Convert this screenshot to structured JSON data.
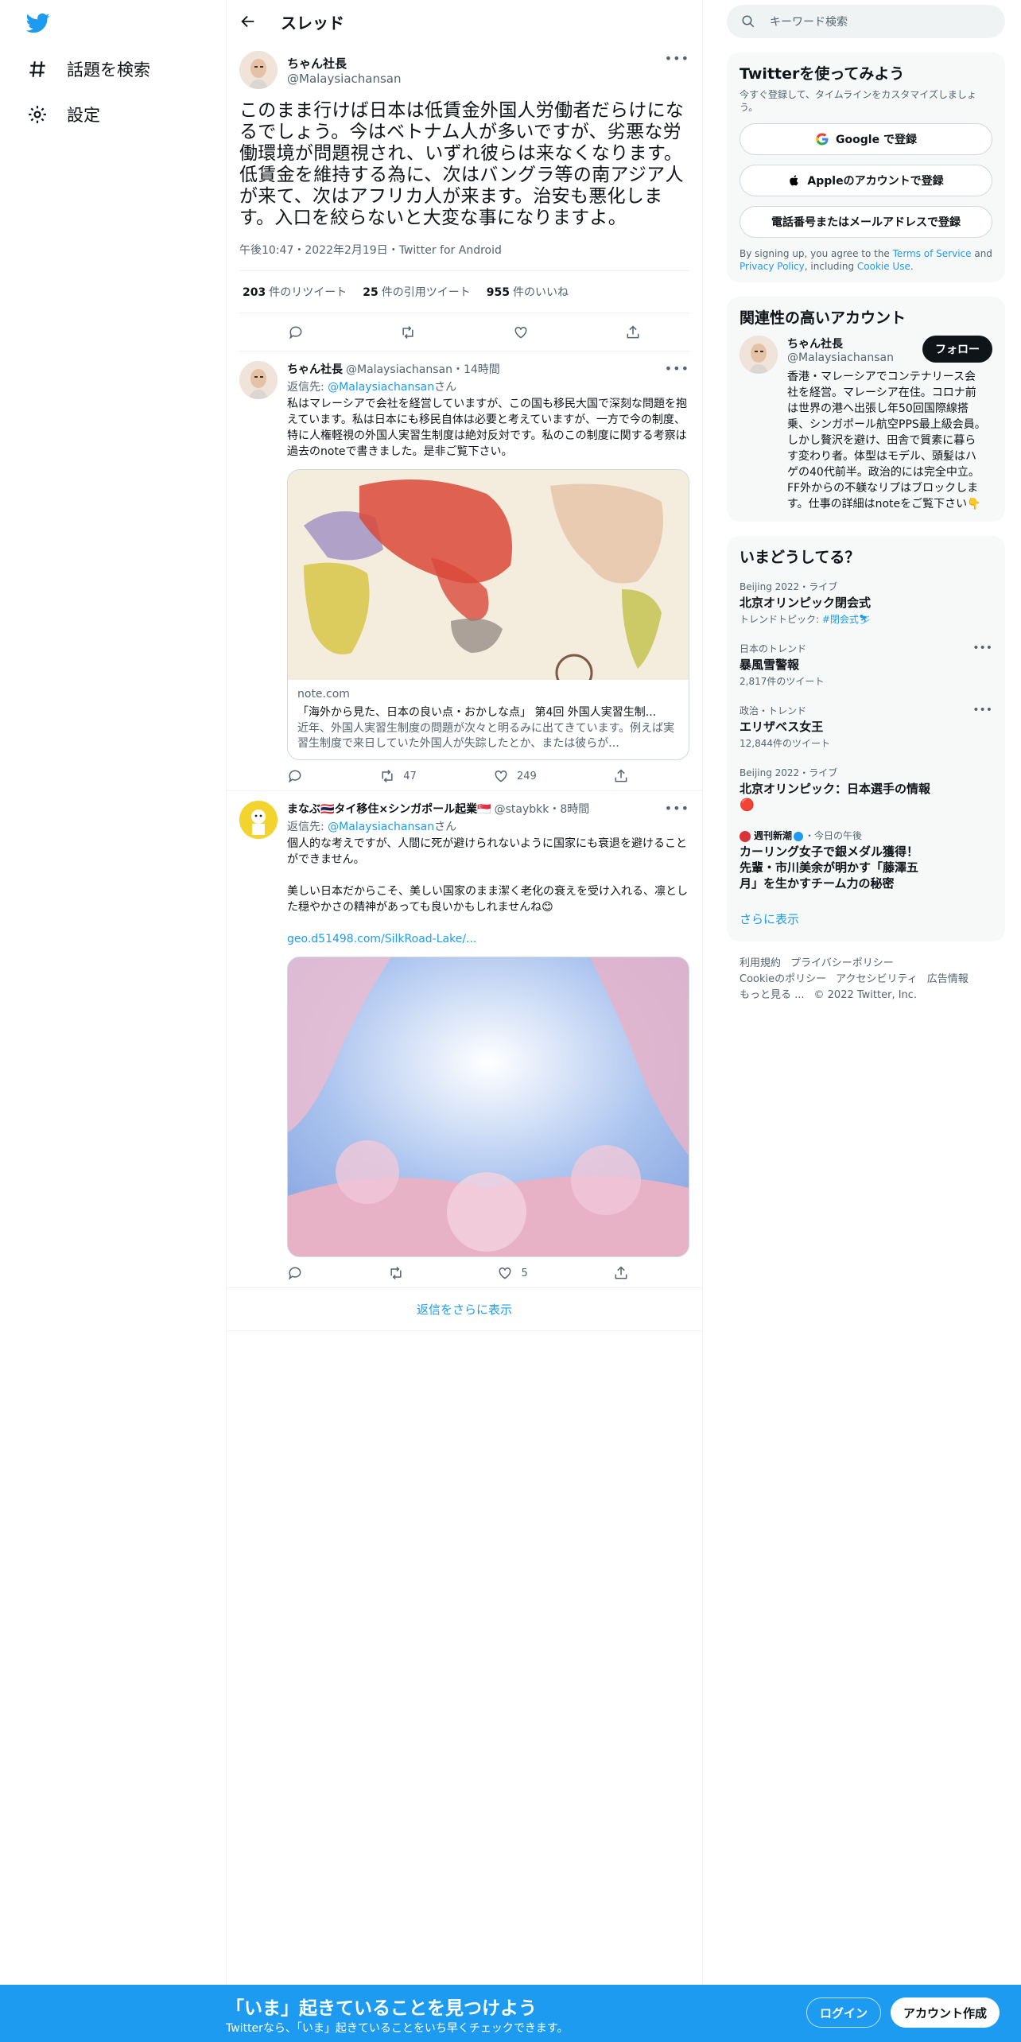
{
  "nav": {
    "explore_label": "話題を検索",
    "settings_label": "設定"
  },
  "header": {
    "title": "スレッド"
  },
  "main_tweet": {
    "name": "ちゃん社長",
    "handle": "@Malaysiachansan",
    "text": "このまま行けば日本は低賃金外国人労働者だらけになるでしょう。今はベトナム人が多いですが、劣悪な労働環境が問題視され、いずれ彼らは来なくなります。低賃金を維持する為に、次はバングラ等の南アジア人が来て、次はアフリカ人が来ます。治安も悪化します。入口を絞らないと大変な事になりますよ。",
    "meta": "午後10:47・2022年2月19日・Twitter for Android",
    "retweets": "203",
    "retweets_label": "件のリツイート",
    "quotes": "25",
    "quotes_label": "件の引用ツイート",
    "likes": "955",
    "likes_label": "件のいいね"
  },
  "replies": [
    {
      "name": "ちゃん社長",
      "handle_time": "@Malaysiachansan・14時間",
      "reply_to_prefix": "返信先: ",
      "reply_to_handle": "@Malaysiachansan",
      "reply_to_suffix": "さん",
      "text": "私はマレーシアで会社を経営していますが、この国も移民大国で深刻な問題を抱えています。私は日本にも移民自体は必要と考えていますが、一方で今の制度、特に人権軽視の外国人実習生制度は絶対反対です。私のこの制度に関する考察は過去のnoteで書きました。是非ご覧下さい。",
      "card_domain": "note.com",
      "card_title": "「海外から見た、日本の良い点・おかしな点」 第4回 外国人実習生制...",
      "card_desc": "近年、外国人実習生制度の問題が次々と明るみに出てきています。例えば実習生制度で来日していた外国人が失踪したとか、または彼らが...",
      "retweets": "47",
      "likes": "249"
    },
    {
      "name": "まなぶ🇹🇭タイ移住×シンガポール起業🇸🇬",
      "handle_time": "@staybkk・8時間",
      "reply_to_prefix": "返信先: ",
      "reply_to_handle": "@Malaysiachansan",
      "reply_to_suffix": "さん",
      "text": "個人的な考えですが、人間に死が避けられないように国家にも衰退を避けることができません。\n\n美しい日本だからこそ、美しい国家のまま潔く老化の衰えを受け入れる、凛とした穏やかさの精神があっても良いかもしれませんね😊",
      "link": "geo.d51498.com/SilkRoad-Lake/...",
      "retweets": "",
      "likes": "5"
    }
  ],
  "more_replies": "返信をさらに表示",
  "search": {
    "placeholder": "キーワード検索"
  },
  "signup_panel": {
    "title": "Twitterを使ってみよう",
    "subtitle": "今すぐ登録して、タイムラインをカスタマイズしましょう。",
    "google": "Google で登録",
    "apple": "Appleのアカウントで登録",
    "phone": "電話番号またはメールアドレスで登録",
    "legal_prefix": "By signing up, you agree to the ",
    "terms": "Terms of Service",
    "and": " and ",
    "privacy": "Privacy Policy",
    "including": ", including ",
    "cookie": "Cookie Use",
    "period": "."
  },
  "related": {
    "title": "関連性の高いアカウント",
    "name": "ちゃん社長",
    "handle": "@Malaysiachansan",
    "follow": "フォロー",
    "bio": "香港・マレーシアでコンテナリース会社を経営。マレーシア在住。コロナ前は世界の港へ出張し年50回国際線搭乗、シンガポール航空PPS最上級会員。しかし贅沢を避け、田舎で質素に暮らす変わり者。体型はモデル、頭髪はハゲの40代前半。政治的には完全中立。FF外からの不躾なリプはブロックします。仕事の詳細はnoteをご覧下さい👇"
  },
  "trends": {
    "title": "いまどうしてる？",
    "items": [
      {
        "meta": "Beijing 2022・ライブ",
        "title": "北京オリンピック閉会式",
        "sub_prefix": "トレンドトピック: ",
        "sub_link": "#閉会式⛷",
        "sub": ""
      },
      {
        "meta": "日本のトレンド",
        "title": "暴風雪警報",
        "sub": "2,817件のツイート"
      },
      {
        "meta": "政治・トレンド",
        "title": "エリザベス女王",
        "sub": "12,844件のツイート"
      },
      {
        "meta": "Beijing 2022・ライブ",
        "title": "北京オリンピック：日本選手の情報🔴",
        "sub": ""
      },
      {
        "meta_source": "週刊新潮",
        "meta_time": "・今日の午後",
        "title": "カーリング女子で銀メダル獲得！ 先輩・市川美余が明かす「藤澤五月」を生かすチーム力の秘密",
        "sub": ""
      }
    ],
    "show_more": "さらに表示"
  },
  "footer": {
    "links": [
      "利用規約",
      "プライバシーポリシー",
      "Cookieのポリシー",
      "アクセシビリティ",
      "広告情報",
      "もっと見る ...",
      "© 2022 Twitter, Inc."
    ]
  },
  "bottom_bar": {
    "title": "「いま」起きていることを見つけよう",
    "subtitle": "Twitterなら、「いま」起きていることをいち早くチェックできます。",
    "login": "ログイン",
    "signup": "アカウント作成"
  },
  "colors": {
    "accent": "#1d9bf0",
    "text": "#0f1419",
    "muted": "#536471"
  }
}
